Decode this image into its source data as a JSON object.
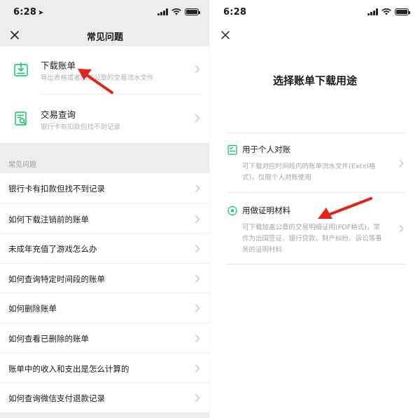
{
  "colors": {
    "accent_green": "#07c160",
    "arrow_red": "#e0251d",
    "left_bg": "#ededed"
  },
  "left": {
    "status_time": "6:28",
    "title": "常见问题",
    "cards": [
      {
        "title": "下载账单",
        "subtitle": "导出表格或者加盖公章的交易流水文件",
        "icon": "download-icon"
      },
      {
        "title": "交易查询",
        "subtitle": "银行卡有扣款但找不到记录",
        "icon": "search-document-icon"
      }
    ],
    "section_title": "常见问题",
    "faq": [
      "银行卡有扣款但找不到记录",
      "如何下载注销前的账单",
      "未成年充值了游戏怎么办",
      "如何查询特定时间段的账单",
      "如何删除账单",
      "如何查看已删除的账单",
      "账单中的收入和支出是怎么计算的",
      "如何查询微信支付退款记录"
    ]
  },
  "right": {
    "status_time": "6:28",
    "heading": "选择账单下载用途",
    "options": [
      {
        "title": "用于个人对账",
        "desc": "可下载对应时间段内的账单流水文件(Excel格式)，仅限个人对账使用",
        "icon": "checklist-icon"
      },
      {
        "title": "用做证明材料",
        "desc": "可下载加盖公章的交易明细证明(PDF格式)，常作为出国签证、银行贷款、财产纠纷、诉讼等事务的证明材料",
        "icon": "seal-star-icon"
      }
    ]
  }
}
